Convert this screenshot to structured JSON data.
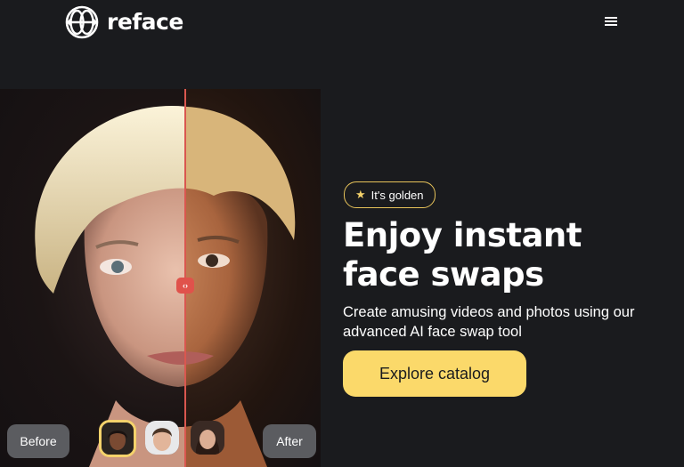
{
  "header": {
    "logo_text": "reface",
    "menu_icon": "hamburger-menu-icon"
  },
  "hero": {
    "before_label": "Before",
    "after_label": "After",
    "handle_label": "‹›",
    "divider_color": "#e0524b",
    "thumbnails": [
      {
        "name": "thumb-woman-dark",
        "active": true
      },
      {
        "name": "thumb-man",
        "active": false
      },
      {
        "name": "thumb-woman-brunette",
        "active": false
      }
    ]
  },
  "content": {
    "badge": "It's golden",
    "headline_line1": "Enjoy instant",
    "headline_line2": "face swaps",
    "subtext": "Create amusing videos and photos using our advanced AI face swap tool",
    "cta": "Explore catalog"
  },
  "colors": {
    "background": "#1a1b1e",
    "accent": "#fbd96a",
    "badge_border": "#e7c35a"
  }
}
